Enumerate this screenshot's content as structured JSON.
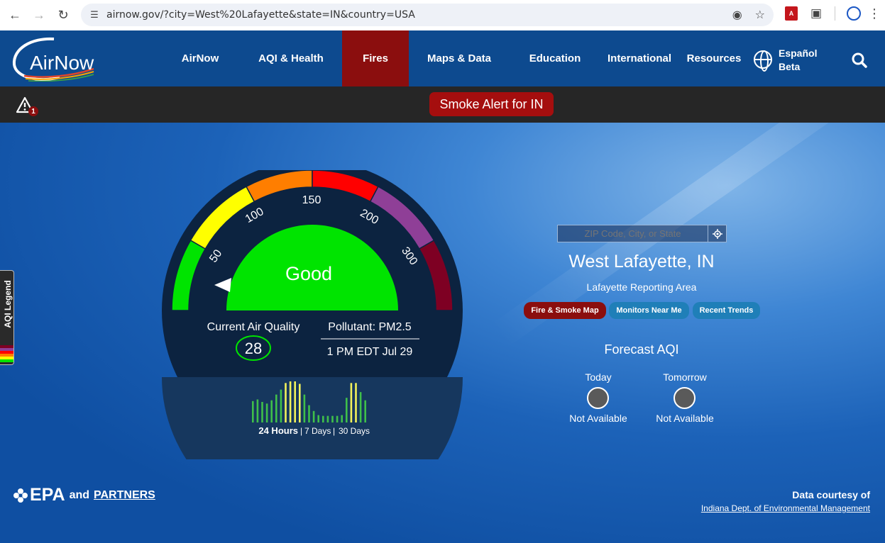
{
  "browser": {
    "url": "airnow.gov/?city=West%20Lafayette&state=IN&country=USA"
  },
  "header": {
    "logo_text": "AirNow",
    "nav": [
      {
        "label": "AirNow"
      },
      {
        "label": "AQI & Health"
      },
      {
        "label": "Fires"
      },
      {
        "label": "Maps & Data"
      },
      {
        "label": "Education"
      },
      {
        "label": "International"
      },
      {
        "label": "Resources"
      }
    ],
    "language_line1": "Español",
    "language_line2": "Beta",
    "accent_color": "#8b0e0e"
  },
  "alert": {
    "count": "1",
    "banner": "Smoke Alert for IN"
  },
  "legend_tab": {
    "label": "AQI Legend",
    "colors": [
      "#00e400",
      "#ffff00",
      "#ff7e00",
      "#ff0000",
      "#8f3f97",
      "#7e0023"
    ]
  },
  "gauge": {
    "ticks": [
      "50",
      "100",
      "150",
      "200",
      "300"
    ],
    "category": "Good",
    "category_color": "#00e400",
    "current_label": "Current Air Quality",
    "aqi_value": "28",
    "pollutant": "Pollutant: PM2.5",
    "timestamp": "1 PM EDT Jul 29",
    "range_active": "24 Hours",
    "range_7": "7 Days",
    "range_30": "30 Days",
    "history_levels": [
      "good",
      "good",
      "good",
      "good",
      "good",
      "good",
      "good",
      "moderate",
      "moderate",
      "moderate",
      "moderate",
      "good",
      "good",
      "good",
      "good",
      "good",
      "good",
      "good",
      "good",
      "good",
      "good",
      "moderate",
      "moderate",
      "good",
      "good"
    ],
    "history_values": [
      0.52,
      0.56,
      0.5,
      0.46,
      0.54,
      0.68,
      0.8,
      0.96,
      1.0,
      1.0,
      0.94,
      0.68,
      0.42,
      0.28,
      0.18,
      0.16,
      0.16,
      0.16,
      0.16,
      0.18,
      0.6,
      0.96,
      0.96,
      0.74,
      0.54
    ]
  },
  "location": {
    "search_placeholder": "ZIP Code, City, or State",
    "city": "West Lafayette, IN",
    "reporting_area": "Lafayette Reporting Area",
    "buttons": [
      {
        "label": "Fire & Smoke Map"
      },
      {
        "label": "Monitors Near Me"
      },
      {
        "label": "Recent Trends"
      }
    ]
  },
  "forecast": {
    "title": "Forecast AQI",
    "days": [
      {
        "label": "Today",
        "status": "Not Available"
      },
      {
        "label": "Tomorrow",
        "status": "Not Available"
      }
    ]
  },
  "footer": {
    "epa": "EPA",
    "and": "and",
    "partners": "PARTNERS",
    "courtesy": "Data courtesy of",
    "agency": "Indiana Dept. of Environmental Management"
  }
}
